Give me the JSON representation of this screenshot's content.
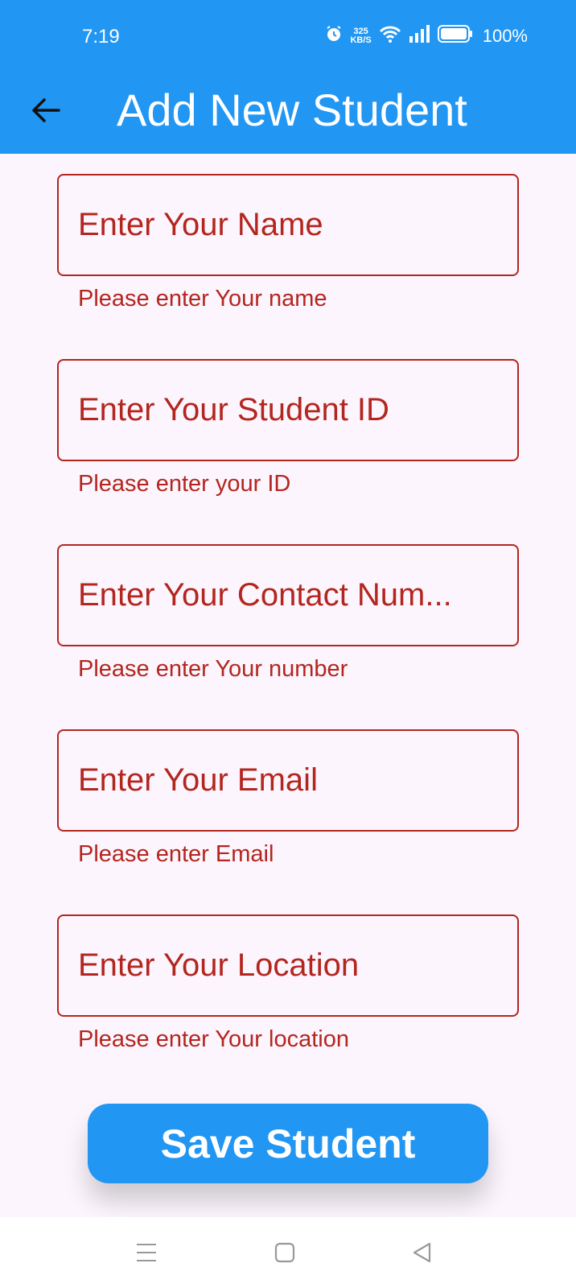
{
  "status_bar": {
    "time": "7:19",
    "speed_value": "325",
    "speed_unit": "KB/S",
    "battery": "100%"
  },
  "appbar": {
    "title": "Add New Student"
  },
  "form": {
    "fields": [
      {
        "placeholder": "Enter Your Name",
        "error": "Please enter Your name"
      },
      {
        "placeholder": "Enter Your Student ID",
        "error": "Please enter your ID"
      },
      {
        "placeholder": "Enter Your Contact Num...",
        "error": "Please enter Your number"
      },
      {
        "placeholder": "Enter Your Email",
        "error": "Please enter Email"
      },
      {
        "placeholder": "Enter Your Location",
        "error": "Please enter Your location"
      }
    ]
  },
  "save_button": {
    "label": "Save Student"
  },
  "colors": {
    "primary": "#2196f3",
    "error": "#b3261e",
    "background": "#fcf5fd"
  }
}
